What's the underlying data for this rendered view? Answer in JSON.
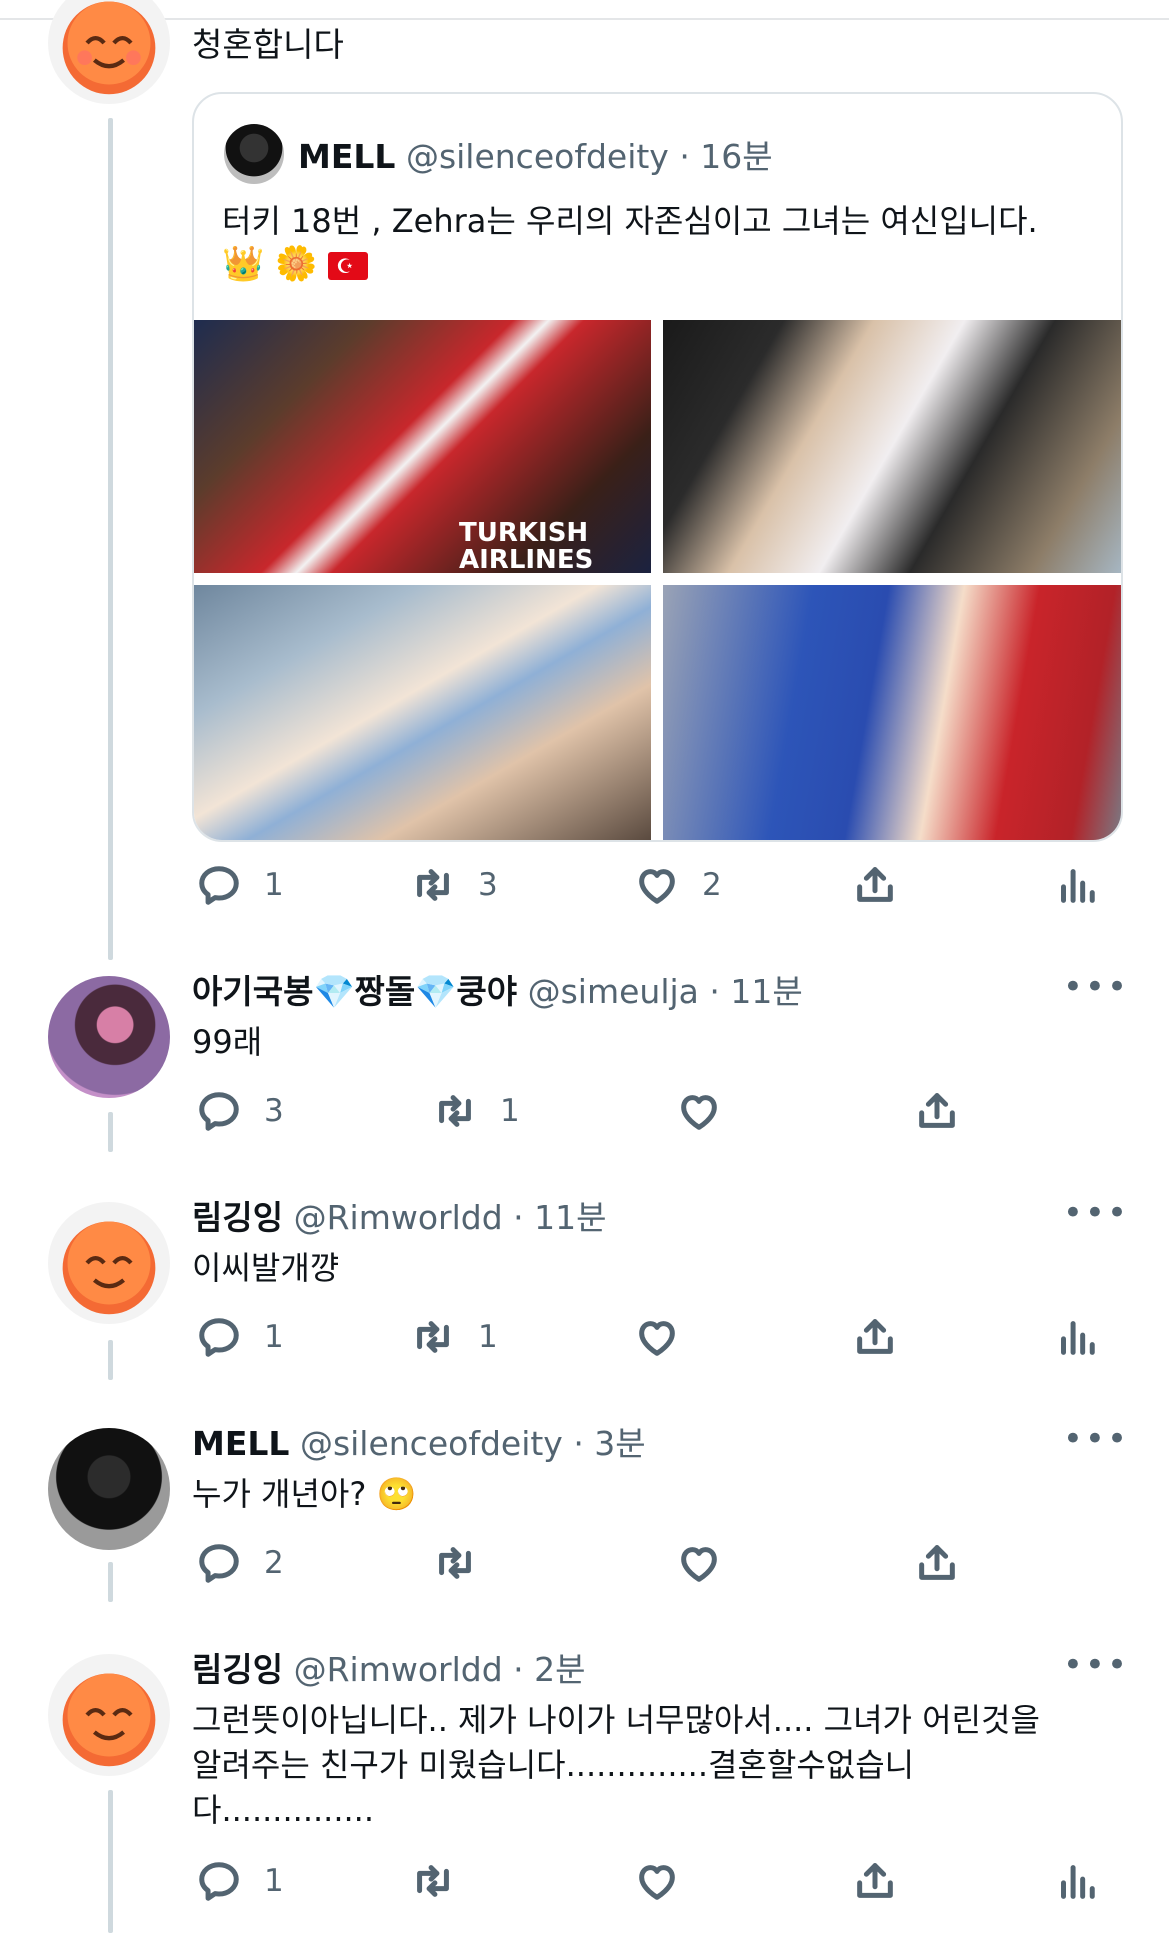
{
  "tweets": [
    {
      "text": "청혼합니다",
      "quote": {
        "name": "MELL",
        "handle": "@silenceofdeity",
        "time": "· 16분",
        "text": "터키 18번 , Zehra는 우리의 자존심이고 그녀는 여신입니다.",
        "emoji": "👑 🌼",
        "flag_icon": "turkey-flag-icon",
        "photos": [
          {
            "label": "TURKISH AIRLINES"
          },
          {
            "label": ""
          },
          {
            "label": ""
          },
          {
            "label": ""
          }
        ]
      },
      "actions": {
        "reply": "1",
        "retweet": "3",
        "like": "2"
      }
    },
    {
      "name_part1": "아기국봉",
      "name_part2": "짱돌",
      "name_part3": "쿵야",
      "name_icon": "gem-icon",
      "handle": "@simeulja",
      "time": "· 11분",
      "text": "99래",
      "actions": {
        "reply": "3",
        "retweet": "1",
        "like": ""
      }
    },
    {
      "name": "림깅잉",
      "handle": "@Rimworldd",
      "time": "· 11분",
      "text": "이씨발개꺙",
      "actions": {
        "reply": "1",
        "retweet": "1",
        "like": ""
      }
    },
    {
      "name": "MELL",
      "handle": "@silenceofdeity",
      "time": "· 3분",
      "text": "누가 개년아? 🙄",
      "actions": {
        "reply": "2",
        "retweet": "",
        "like": ""
      }
    },
    {
      "name": "림깅잉",
      "handle": "@Rimworldd",
      "time": "· 2분",
      "text": "그런뜻이아닙니다.. 제가 나이가 너무많아서.... 그녀가 어린것을\n알려주는 친구가 미웠습니다..............결혼할수없습니\n다...............",
      "actions": {
        "reply": "1",
        "retweet": "",
        "like": ""
      }
    }
  ],
  "more_label": "•••",
  "avatar_emoji": "🥰"
}
